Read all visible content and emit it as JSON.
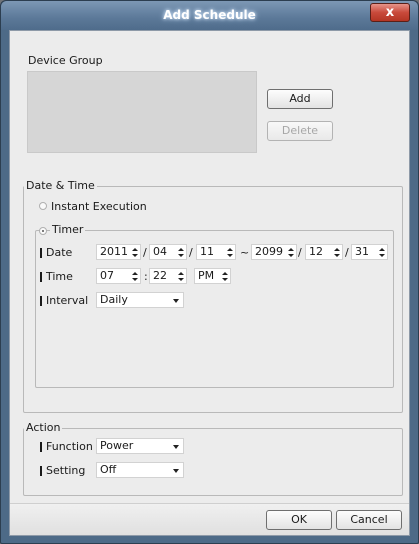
{
  "window": {
    "title": "Add Schedule",
    "close_glyph": "x"
  },
  "device_group": {
    "label": "Device Group",
    "add_label": "Add",
    "delete_label": "Delete"
  },
  "date_time": {
    "label": "Date & Time",
    "instant_execution_label": "Instant Execution",
    "timer_label": "Timer",
    "selected_mode": "Timer",
    "date": {
      "label": "Date",
      "start": {
        "year": "2011",
        "month": "04",
        "day": "11"
      },
      "range_sep": "~",
      "end": {
        "year": "2099",
        "month": "12",
        "day": "31"
      },
      "sep": "/"
    },
    "time": {
      "label": "Time",
      "hour": "07",
      "colon": ":",
      "minute": "22",
      "ampm": "PM"
    },
    "interval": {
      "label": "Interval",
      "value": "Daily"
    }
  },
  "action": {
    "label": "Action",
    "function": {
      "label": "Function",
      "value": "Power"
    },
    "setting": {
      "label": "Setting",
      "value": "Off"
    }
  },
  "footer": {
    "ok_label": "OK",
    "cancel_label": "Cancel"
  },
  "colors": {
    "title_bar": "#5b7898",
    "close_button": "#c94a3b",
    "client_bg": "#ececec"
  }
}
